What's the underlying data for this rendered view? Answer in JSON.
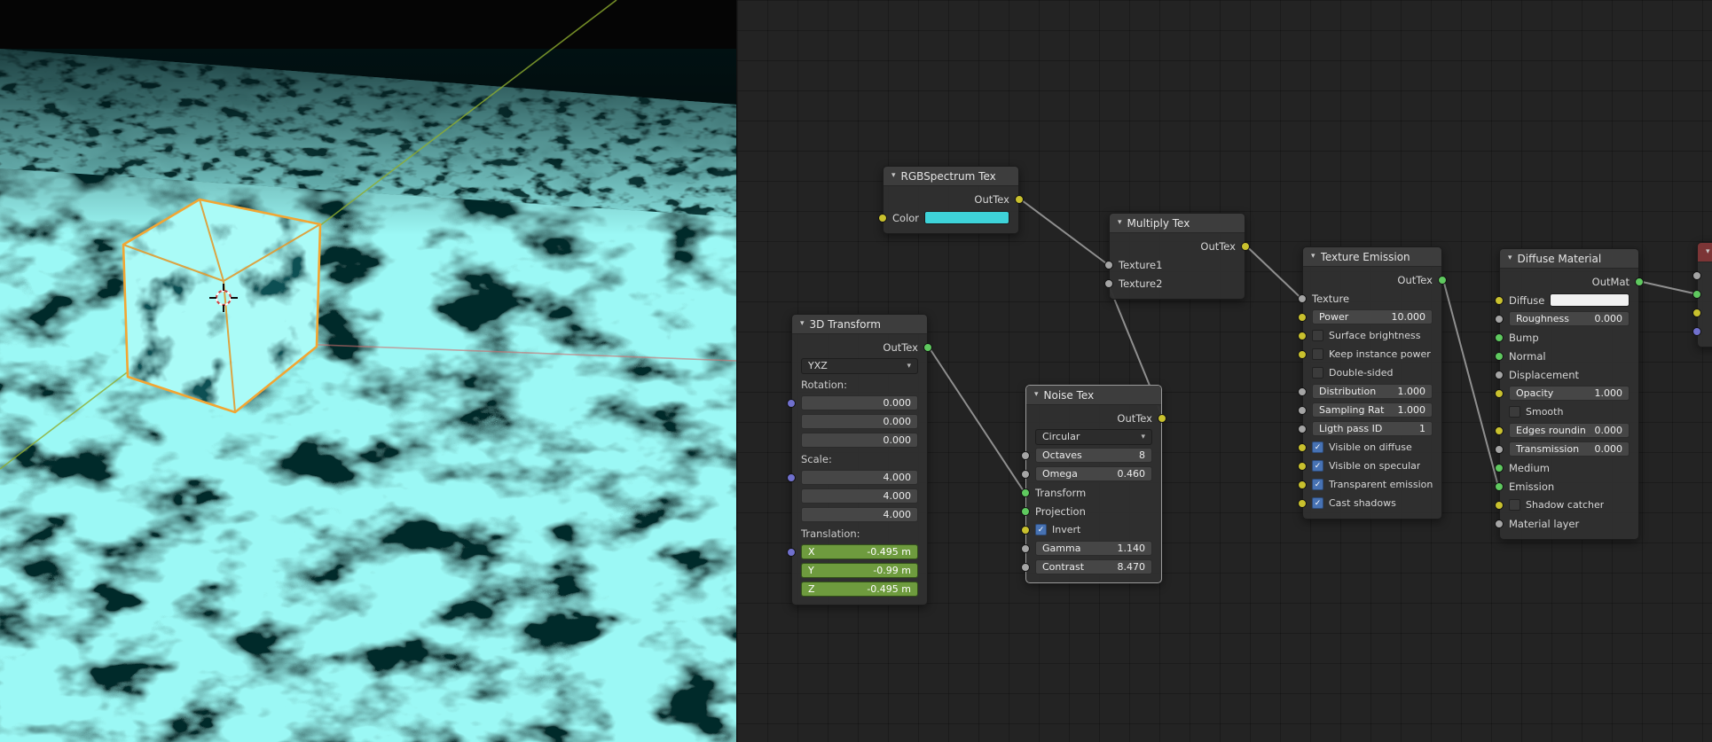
{
  "viewport": {
    "water_base_color": "#05292b",
    "caustic_color": "#59f2eb",
    "selection_outline_color": "#f2a633",
    "axis_green_color": "#8fae2f",
    "axis_red_color": "#cf6f6f"
  },
  "editor": {
    "background_color": "#232323",
    "wire_color": "#a2a2a2",
    "socket_colors": {
      "texture": "#c9c12e",
      "value": "#a5a5a5",
      "material": "#5fc95f",
      "vector": "#7070cd"
    },
    "links": [
      {
        "from": "RGBSpectrum Tex / OutTex",
        "to": "Multiply Tex / Texture1"
      },
      {
        "from": "Noise Tex / OutTex",
        "to": "Multiply Tex / Texture2"
      },
      {
        "from": "3D Transform / OutTex",
        "to": "Noise Tex / Transform"
      },
      {
        "from": "Multiply Tex / OutTex",
        "to": "Texture Emission / Texture"
      },
      {
        "from": "Texture Emission / OutTex",
        "to": "Diffuse Material / Emission"
      },
      {
        "from": "Diffuse Material / OutMat",
        "to": "node clipped at right edge"
      }
    ]
  },
  "nodes": {
    "rgbspectrum": {
      "title": "RGBSpectrum Tex",
      "out_label": "OutTex",
      "color_label": "Color",
      "color_swatch": "#3ed3d9"
    },
    "multiply": {
      "title": "Multiply Tex",
      "out_label": "OutTex",
      "texture1_label": "Texture1",
      "texture2_label": "Texture2"
    },
    "transform3d": {
      "title": "3D Transform",
      "out_label": "OutTex",
      "order_value": "YXZ",
      "rotation_label": "Rotation:",
      "rotation_values": [
        "0.000",
        "0.000",
        "0.000"
      ],
      "scale_label": "Scale:",
      "scale_values": [
        "4.000",
        "4.000",
        "4.000"
      ],
      "translation_label": "Translation:",
      "translation_rows": [
        {
          "axis": "X",
          "value": "-0.495 m"
        },
        {
          "axis": "Y",
          "value": "-0.99 m"
        },
        {
          "axis": "Z",
          "value": "-0.495 m"
        }
      ]
    },
    "noise": {
      "title": "Noise Tex",
      "out_label": "OutTex",
      "mode_value": "Circular",
      "octaves_label": "Octaves",
      "octaves_value": "8",
      "omega_label": "Omega",
      "omega_value": "0.460",
      "transform_label": "Transform",
      "projection_label": "Projection",
      "invert_label": "Invert",
      "invert_checked": true,
      "gamma_label": "Gamma",
      "gamma_value": "1.140",
      "contrast_label": "Contrast",
      "contrast_value": "8.470"
    },
    "emission": {
      "title": "Texture Emission",
      "out_label": "OutTex",
      "texture_label": "Texture",
      "power_label": "Power",
      "power_value": "10.000",
      "surface_brightness_label": "Surface brightness",
      "surface_brightness_checked": false,
      "keep_instance_label": "Keep instance power",
      "keep_instance_checked": false,
      "double_sided_label": "Double-sided",
      "double_sided_checked": false,
      "distribution_label": "Distribution",
      "distribution_value": "1.000",
      "sampling_label": "Sampling Rat",
      "sampling_value": "1.000",
      "lightpass_label": "Ligth pass ID",
      "lightpass_value": "1",
      "visible_diffuse_label": "Visible on diffuse",
      "visible_diffuse_checked": true,
      "visible_specular_label": "Visible on specular",
      "visible_specular_checked": true,
      "transparent_emission_label": "Transparent emission",
      "transparent_emission_checked": true,
      "cast_shadows_label": "Cast shadows",
      "cast_shadows_checked": true
    },
    "diffuse": {
      "title": "Diffuse Material",
      "out_label": "OutMat",
      "diffuse_label": "Diffuse",
      "diffuse_swatch": "#f1f1f1",
      "roughness_label": "Roughness",
      "roughness_value": "0.000",
      "bump_label": "Bump",
      "normal_label": "Normal",
      "displacement_label": "Displacement",
      "opacity_label": "Opacity",
      "opacity_value": "1.000",
      "smooth_label": "Smooth",
      "smooth_checked": false,
      "edges_label": "Edges roundin",
      "edges_value": "0.000",
      "transmission_label": "Transmission",
      "transmission_value": "0.000",
      "medium_label": "Medium",
      "emission_label": "Emission",
      "shadow_catcher_label": "Shadow catcher",
      "shadow_catcher_checked": false,
      "material_layer_label": "Material layer"
    },
    "clipped": {
      "header_color": "#7c3536"
    }
  }
}
